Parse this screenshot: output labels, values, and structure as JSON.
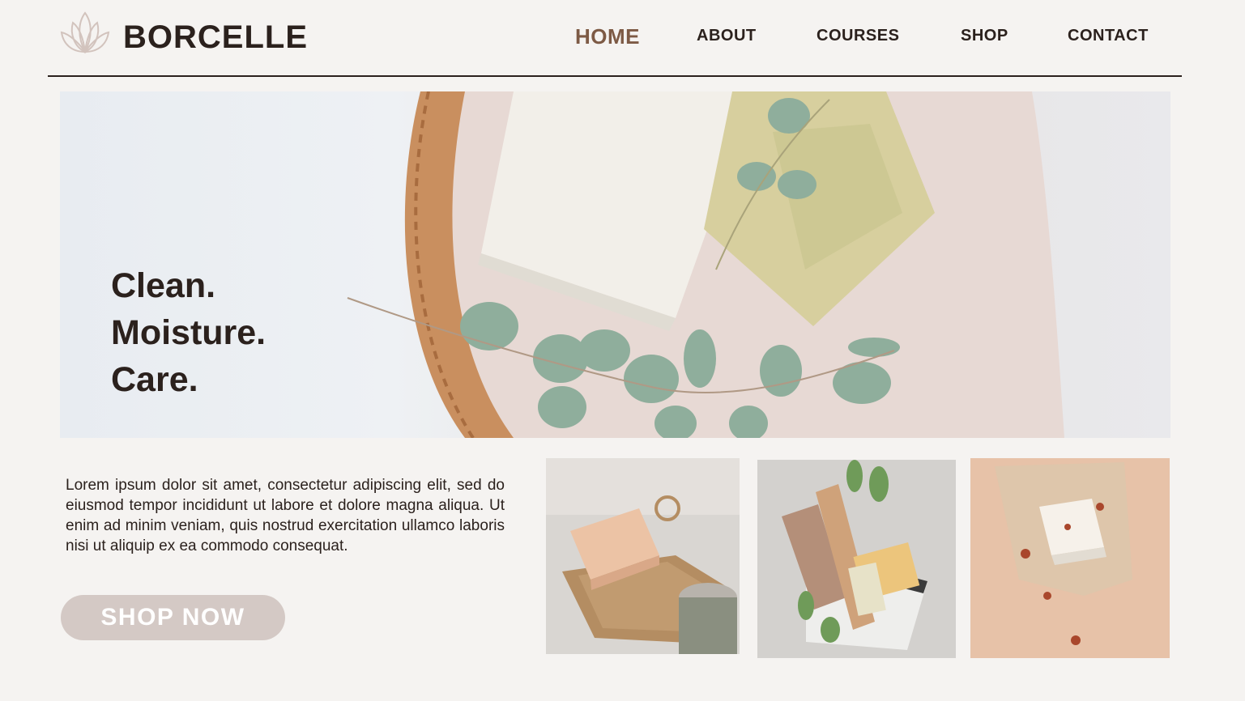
{
  "brand": {
    "name": "BORCELLE",
    "icon": "lotus-icon"
  },
  "nav": {
    "items": [
      {
        "label": "HOME"
      },
      {
        "label": "ABOUT"
      },
      {
        "label": "COURSES"
      },
      {
        "label": "SHOP"
      },
      {
        "label": "CONTACT"
      }
    ],
    "active": "HOME"
  },
  "hero": {
    "lines": [
      "Clean.",
      "Moisture.",
      "Care."
    ]
  },
  "intro": {
    "text": "Lorem ipsum dolor sit amet, consectetur adipiscing elit, sed do eiusmod tempor incididunt ut labore et dolore magna aliqua. Ut enim ad minim veniam, quis nostrud exercitation ullamco laboris nisi ut aliquip ex ea commodo consequat."
  },
  "cta": {
    "label": "SHOP NOW"
  },
  "colors": {
    "background": "#f5f3f1",
    "text": "#2b211d",
    "accent": "#7d5a45",
    "button": "#d4c9c5"
  }
}
